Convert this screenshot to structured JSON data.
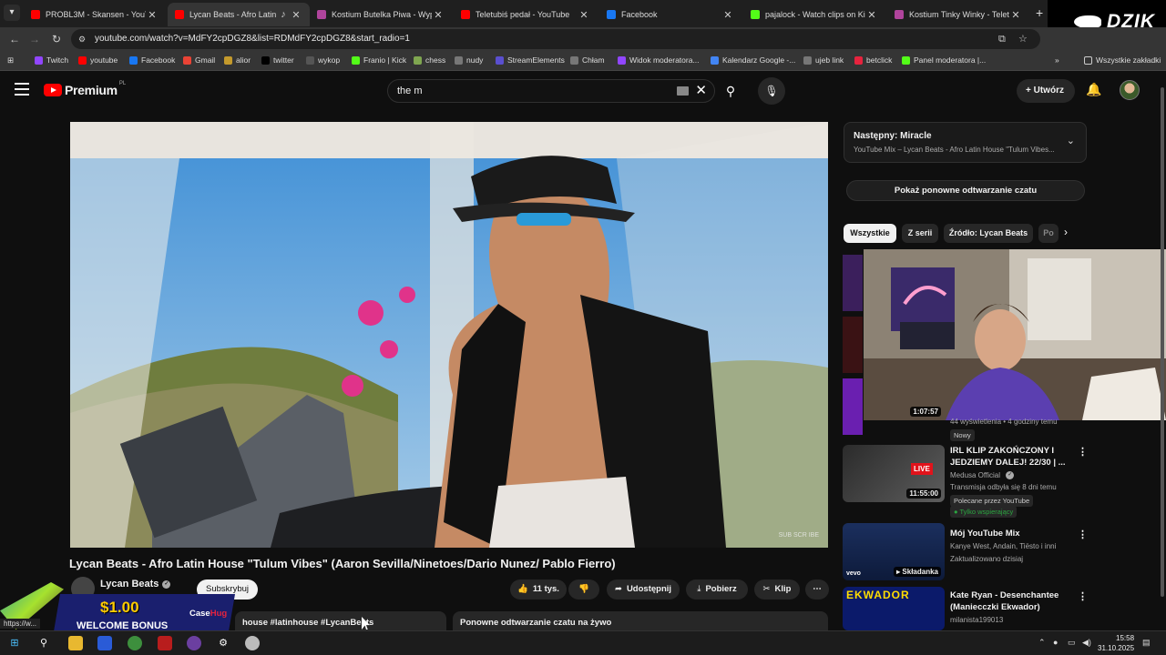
{
  "browser": {
    "tabs": [
      {
        "label": "PROBL3M - Skansen - YouTube",
        "favicon": "youtube-icon",
        "color": "#ff0000"
      },
      {
        "label": "Lycan Beats - Afro Latin Ho",
        "favicon": "youtube-icon",
        "color": "#ff0000",
        "active": true
      },
      {
        "label": "Kostium Butelka Piwa - Wypoży",
        "favicon": "m-icon",
        "color": "#b0449c"
      },
      {
        "label": "Teletubiś pedał - YouTube",
        "favicon": "youtube-icon",
        "color": "#ff0000"
      },
      {
        "label": "Facebook",
        "favicon": "facebook-icon",
        "color": "#1877f2"
      },
      {
        "label": "pajalock - Watch clips on Kick",
        "favicon": "kick-icon",
        "color": "#53fc18"
      },
      {
        "label": "Kostium Tinky Winky - Teletub",
        "favicon": "m-icon",
        "color": "#b0449c"
      }
    ],
    "url": "youtube.com/watch?v=MdFY2cpDGZ8&list=RDMdFY2cpDGZ8&start_radio=1",
    "overlay_logo": "DZIK",
    "bookmarks": [
      {
        "label": "Twitch",
        "color": "#9146ff"
      },
      {
        "label": "youtube",
        "color": "#ff0000"
      },
      {
        "label": "Facebook",
        "color": "#1877f2"
      },
      {
        "label": "Gmail",
        "color": "#ea4335"
      },
      {
        "label": "alior",
        "color": "#c49a2c"
      },
      {
        "label": "twitter",
        "color": "#000000"
      },
      {
        "label": "wykop",
        "color": "#555555"
      },
      {
        "label": "Franio | Kick",
        "color": "#53fc18"
      },
      {
        "label": "chess",
        "color": "#7fa650"
      },
      {
        "label": "nudy",
        "color": "#777777"
      },
      {
        "label": "StreamElements",
        "color": "#5a4fcf"
      },
      {
        "label": "Chłam",
        "color": "#777777"
      },
      {
        "label": "Widok moderatora...",
        "color": "#9146ff"
      },
      {
        "label": "Kalendarz Google -...",
        "color": "#4285f4"
      },
      {
        "label": "ujeb link",
        "color": "#777777"
      },
      {
        "label": "betclick",
        "color": "#e7233e"
      },
      {
        "label": "Panel moderatora |...",
        "color": "#53fc18"
      }
    ],
    "all_bookmarks": "Wszystkie zakładki"
  },
  "youtube": {
    "logo": "Premium",
    "logo_region": "PL",
    "search_value": "the m",
    "create_label": "Utwórz"
  },
  "video": {
    "title": "Lycan Beats - Afro Latin House \"Tulum Vibes\" (Aaron Sevilla/Ninetoes/Dario Nunez/ Pablo Fierro)",
    "channel": "Lycan Beats",
    "subscribe_label": "Subskrybuj",
    "likes": "11 tys.",
    "share_label": "Udostępnij",
    "download_label": "Pobierz",
    "clip_label": "Klip",
    "description_snippet": "house #latinhouse #LycanBeats",
    "replay_chat_label": "Ponowne odtwarzanie czatu na żywo",
    "watermark": "SUB SCR IBE"
  },
  "secondary": {
    "next_title": "Następny: Miracle",
    "next_sub": "YouTube Mix – Lycan Beats - Afro Latin House \"Tulum Vibes...",
    "replay_button": "Pokaż ponowne odtwarzanie czatu",
    "chips": [
      "Wszystkie",
      "Z serii",
      "Źródło: Lycan Beats",
      "Po"
    ],
    "first_duration": "1:07:57",
    "first_meta": "44 wyświetlenia • 4 godziny temu",
    "first_badge": "Nowy",
    "recs": [
      {
        "title": "IRL KLIP ZAKOŃCZONY I JEDZIEMY DALEJ! 22/30 | ...",
        "channel": "Medusa Official",
        "meta": "Transmisja odbyła się 8 dni temu",
        "badge": "Polecane przez YouTube",
        "badge2": "Tylko wspierający",
        "duration": "11:55:00"
      },
      {
        "title": "Mój YouTube Mix",
        "channel": "Kanye West, Andain, Tiësto i inni",
        "meta": "Zaktualizowano dzisiaj",
        "duration": "Składanka"
      },
      {
        "title": "Kate Ryan - Desenchantee (Maniecczki Ekwador)",
        "channel": "milanista199013",
        "thumb_text": "EKWADOR"
      }
    ]
  },
  "ad": {
    "amount": "$1.00",
    "text": "WELCOME BONUS",
    "brand_a": "Case",
    "brand_b": "Hug"
  },
  "status_url": "https://w...",
  "taskbar": {
    "time": "15:58",
    "date": "31.10.2025"
  }
}
